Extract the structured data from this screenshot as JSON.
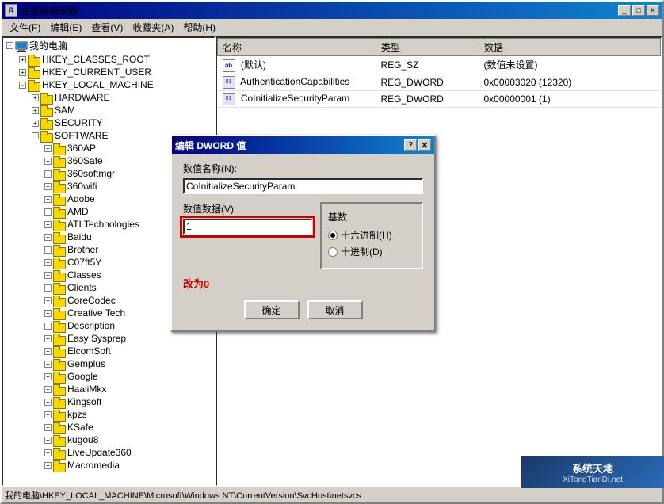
{
  "window": {
    "title": "注册表编辑器",
    "minimize_label": "_",
    "maximize_label": "□",
    "close_label": "✕"
  },
  "menu": {
    "items": [
      "文件(F)",
      "编辑(E)",
      "查看(V)",
      "收藏夹(A)",
      "帮助(H)"
    ]
  },
  "tree": {
    "items": [
      {
        "label": "我的电脑",
        "level": 1,
        "expanded": true,
        "type": "pc"
      },
      {
        "label": "HKEY_CLASSES_ROOT",
        "level": 2,
        "expanded": false,
        "type": "folder"
      },
      {
        "label": "HKEY_CURRENT_USER",
        "level": 2,
        "expanded": false,
        "type": "folder"
      },
      {
        "label": "HKEY_LOCAL_MACHINE",
        "level": 2,
        "expanded": true,
        "type": "folder"
      },
      {
        "label": "HARDWARE",
        "level": 3,
        "expanded": false,
        "type": "folder"
      },
      {
        "label": "SAM",
        "level": 3,
        "expanded": false,
        "type": "folder"
      },
      {
        "label": "SECURITY",
        "level": 3,
        "expanded": false,
        "type": "folder"
      },
      {
        "label": "SOFTWARE",
        "level": 3,
        "expanded": true,
        "type": "folder"
      },
      {
        "label": "360AP",
        "level": 4,
        "expanded": false,
        "type": "folder"
      },
      {
        "label": "360Safe",
        "level": 4,
        "expanded": false,
        "type": "folder"
      },
      {
        "label": "360softmgr",
        "level": 4,
        "expanded": false,
        "type": "folder"
      },
      {
        "label": "360wifi",
        "level": 4,
        "expanded": false,
        "type": "folder"
      },
      {
        "label": "Adobe",
        "level": 4,
        "expanded": false,
        "type": "folder"
      },
      {
        "label": "AMD",
        "level": 4,
        "expanded": false,
        "type": "folder"
      },
      {
        "label": "ATI Technologies",
        "level": 4,
        "expanded": false,
        "type": "folder"
      },
      {
        "label": "Baidu",
        "level": 4,
        "expanded": false,
        "type": "folder"
      },
      {
        "label": "Brother",
        "level": 4,
        "expanded": false,
        "type": "folder"
      },
      {
        "label": "C07ft5Y",
        "level": 4,
        "expanded": false,
        "type": "folder"
      },
      {
        "label": "Classes",
        "level": 4,
        "expanded": false,
        "type": "folder"
      },
      {
        "label": "Clients",
        "level": 4,
        "expanded": false,
        "type": "folder"
      },
      {
        "label": "CoreCodec",
        "level": 4,
        "expanded": false,
        "type": "folder"
      },
      {
        "label": "Creative Tech",
        "level": 4,
        "expanded": false,
        "type": "folder"
      },
      {
        "label": "Description",
        "level": 4,
        "expanded": false,
        "type": "folder"
      },
      {
        "label": "Easy Sysprep",
        "level": 4,
        "expanded": false,
        "type": "folder"
      },
      {
        "label": "ElcomSoft",
        "level": 4,
        "expanded": false,
        "type": "folder"
      },
      {
        "label": "Gemplus",
        "level": 4,
        "expanded": false,
        "type": "folder"
      },
      {
        "label": "Google",
        "level": 4,
        "expanded": false,
        "type": "folder"
      },
      {
        "label": "HaaliMkx",
        "level": 4,
        "expanded": false,
        "type": "folder"
      },
      {
        "label": "Kingsoft",
        "level": 4,
        "expanded": false,
        "type": "folder"
      },
      {
        "label": "kpzs",
        "level": 4,
        "expanded": false,
        "type": "folder"
      },
      {
        "label": "KSafe",
        "level": 4,
        "expanded": false,
        "type": "folder"
      },
      {
        "label": "kugou8",
        "level": 4,
        "expanded": false,
        "type": "folder"
      },
      {
        "label": "LiveUpdate360",
        "level": 4,
        "expanded": false,
        "type": "folder"
      },
      {
        "label": "Macromedia",
        "level": 4,
        "expanded": false,
        "type": "folder"
      }
    ]
  },
  "registry_table": {
    "columns": [
      "名称",
      "类型",
      "数据"
    ],
    "rows": [
      {
        "name": "(默认)",
        "type": "REG_SZ",
        "data": "(数值未设置)",
        "icon": "ab"
      },
      {
        "name": "AuthenticationCapabilities",
        "type": "REG_DWORD",
        "data": "0x00003020 (12320)",
        "icon": "dword"
      },
      {
        "name": "CoInitializeSecurityParam",
        "type": "REG_DWORD",
        "data": "0x00000001 (1)",
        "icon": "dword"
      }
    ]
  },
  "status_bar": {
    "text": "我的电脑\\HKEY_LOCAL_MACHINE\\Microsoft\\Windows NT\\CurrentVersion\\SvcHost\\netsvcs"
  },
  "dialog": {
    "title": "编辑 DWORD 值",
    "help_btn": "?",
    "close_btn": "✕",
    "name_label": "数值名称(N):",
    "name_value": "CoInitializeSecurityParam",
    "data_label": "数值数据(V):",
    "data_value": "1",
    "base_label": "基数",
    "radio_hex": "十六进制(H)",
    "radio_dec": "十进制(D)",
    "change_label": "改为0",
    "ok_btn": "确定",
    "cancel_btn": "取消"
  },
  "watermark": {
    "line1": "系统天地",
    "line2": "XiTongTianDi.net"
  }
}
